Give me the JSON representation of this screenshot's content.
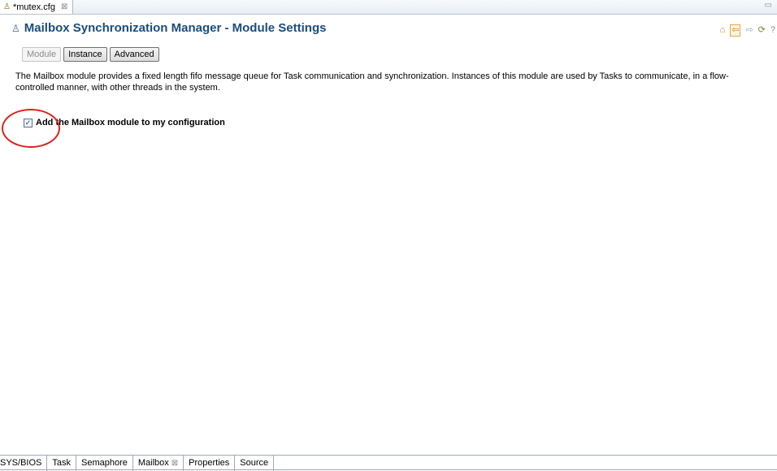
{
  "editor_tab": {
    "title": "*mutex.cfg",
    "icon": "config-file-icon",
    "close_glyph": "⊠"
  },
  "header": {
    "title": "Mailbox Synchronization Manager - Module Settings",
    "icon": "module-icon"
  },
  "nav": {
    "home": "⌂",
    "back": "⇦",
    "forward": "⇨",
    "refresh": "⟳",
    "help": "?"
  },
  "buttons": {
    "module": "Module",
    "instance": "Instance",
    "advanced": "Advanced"
  },
  "description": "The Mailbox module provides a fixed length fifo message queue for Task communication and synchronization. Instances of this module are used by Tasks to communicate, in a flow-controlled manner, with other threads in the system.",
  "checkbox": {
    "label": "Add the Mailbox module to my configuration",
    "checked": true,
    "check_glyph": "✓"
  },
  "bottom_tabs": [
    {
      "label": "SYS/BIOS",
      "active": false
    },
    {
      "label": "Task",
      "active": false
    },
    {
      "label": "Semaphore",
      "active": false
    },
    {
      "label": "Mailbox",
      "active": true,
      "close_glyph": "⊠"
    },
    {
      "label": "Properties",
      "active": false
    },
    {
      "label": "Source",
      "active": false
    }
  ],
  "colors": {
    "title": "#1a4d7d",
    "annotation": "#d9231a"
  }
}
